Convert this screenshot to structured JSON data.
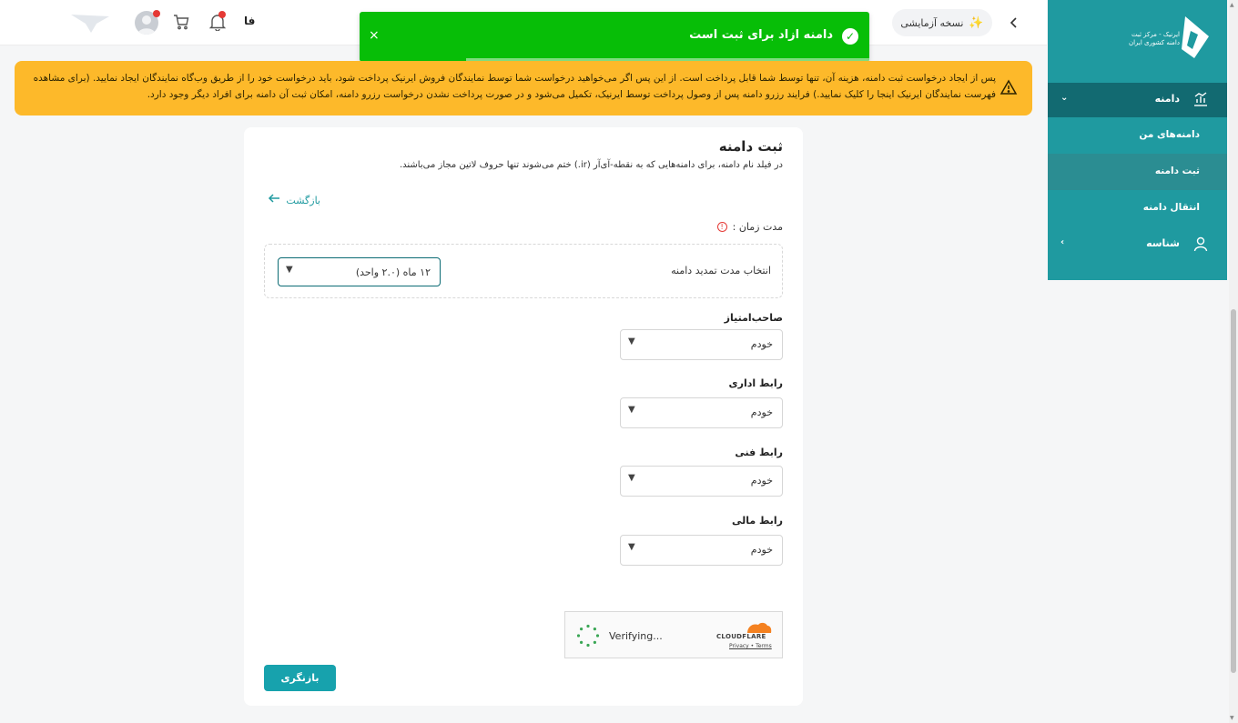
{
  "header": {
    "trial_label": "نسخه آزمایشی",
    "lang": "فا"
  },
  "toast": {
    "message": "دامنه ازاد برای ثبت است",
    "close": "×"
  },
  "warning": {
    "text": "پس از ایجاد درخواست ثبت دامنه، هزینه آن، تنها توسط شما قابل پرداخت است. از این پس اگر می‌خواهید درخواست شما توسط نمایندگان فروش ایرنیک پرداخت شود، باید درخواست خود را از طریق وب‌گاه نمایندگان ایجاد نمایید. (برای مشاهده فهرست نمایندگان ایرنیک اینجا را کلیک نمایید.) فرایند رزرو دامنه پس از وصول پرداخت توسط ایرنیک، تکمیل می‌شود و در صورت پرداخت نشدن درخواست رزرو دامنه، امکان ثبت آن دامنه برای افراد دیگر وجود دارد."
  },
  "sidebar": {
    "logo_line1": "ایرنیک - مرکز ثبت",
    "logo_line2": "دامنه کشوری ایران",
    "menu_domain": "دامنه",
    "items": [
      {
        "label": "دامنه‌های من"
      },
      {
        "label": "ثبت دامنه"
      },
      {
        "label": "انتقال دامنه"
      }
    ],
    "menu_identity": "شناسه"
  },
  "card": {
    "title": "ثبت دامنه",
    "subtitle": "در فیلد نام دامنه، برای دامنه‌هایی که به نقطه-آی‌آر (ir.) ختم می‌شوند تنها حروف لاتین مجاز می‌باشند.",
    "back_link": "بازگشت",
    "duration_label": "مدت زمان :",
    "duration_prompt": "انتخاب مدت تمدید دامنه",
    "duration_value": "۱۲ ماه (۲.۰ واحد)",
    "fields": [
      {
        "label": "صاحب‌امتیاز",
        "value": "خودم"
      },
      {
        "label": "رابط اداری",
        "value": "خودم"
      },
      {
        "label": "رابط فنی",
        "value": "خودم"
      },
      {
        "label": "رابط مالی",
        "value": "خودم"
      }
    ],
    "captcha_status": "Verifying...",
    "captcha_brand": "CLOUDFLARE",
    "captcha_links": "Privacy • Terms",
    "submit_back": "بازنگری"
  }
}
